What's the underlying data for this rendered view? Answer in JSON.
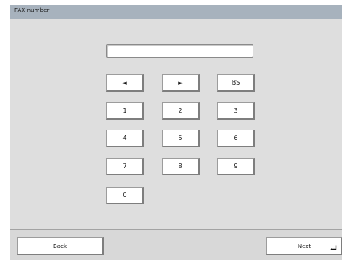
{
  "window": {
    "title": "FAX number"
  },
  "fax_input": {
    "value": ""
  },
  "keypad": {
    "left_glyph": "◄",
    "right_glyph": "►",
    "backspace_label": "BS",
    "digits": [
      "1",
      "2",
      "3",
      "4",
      "5",
      "6",
      "7",
      "8",
      "9",
      "0"
    ]
  },
  "footer": {
    "back_label": "Back",
    "next_label": "Next"
  },
  "icons": {
    "left": "left-arrow-icon",
    "right": "right-arrow-icon",
    "enter": "enter-icon"
  }
}
